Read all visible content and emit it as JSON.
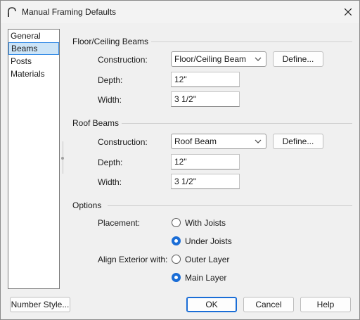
{
  "window": {
    "title": "Manual Framing Defaults",
    "icon": "arch-icon"
  },
  "nav": {
    "items": [
      {
        "label": "General",
        "selected": false
      },
      {
        "label": "Beams",
        "selected": true
      },
      {
        "label": "Posts",
        "selected": false
      },
      {
        "label": "Materials",
        "selected": false
      }
    ]
  },
  "floor_ceiling": {
    "title": "Floor/Ceiling Beams",
    "construction_label": "Construction:",
    "construction_value": "Floor/Ceiling Beam",
    "define_label": "Define...",
    "depth_label": "Depth:",
    "depth_value": "12\"",
    "width_label": "Width:",
    "width_value": "3 1/2\""
  },
  "roof": {
    "title": "Roof Beams",
    "construction_label": "Construction:",
    "construction_value": "Roof Beam",
    "define_label": "Define...",
    "depth_label": "Depth:",
    "depth_value": "12\"",
    "width_label": "Width:",
    "width_value": "3 1/2\""
  },
  "options": {
    "title": "Options",
    "placement_label": "Placement:",
    "placement_opts": [
      "With Joists",
      "Under Joists"
    ],
    "placement_selected": "Under Joists",
    "align_label": "Align Exterior with:",
    "align_opts": [
      "Outer Layer",
      "Main Layer"
    ],
    "align_selected": "Main Layer"
  },
  "footer": {
    "number_style_label": "Number Style...",
    "ok_label": "OK",
    "cancel_label": "Cancel",
    "help_label": "Help"
  },
  "colors": {
    "accent": "#1a6dd6",
    "selection": "#cce4f7"
  }
}
